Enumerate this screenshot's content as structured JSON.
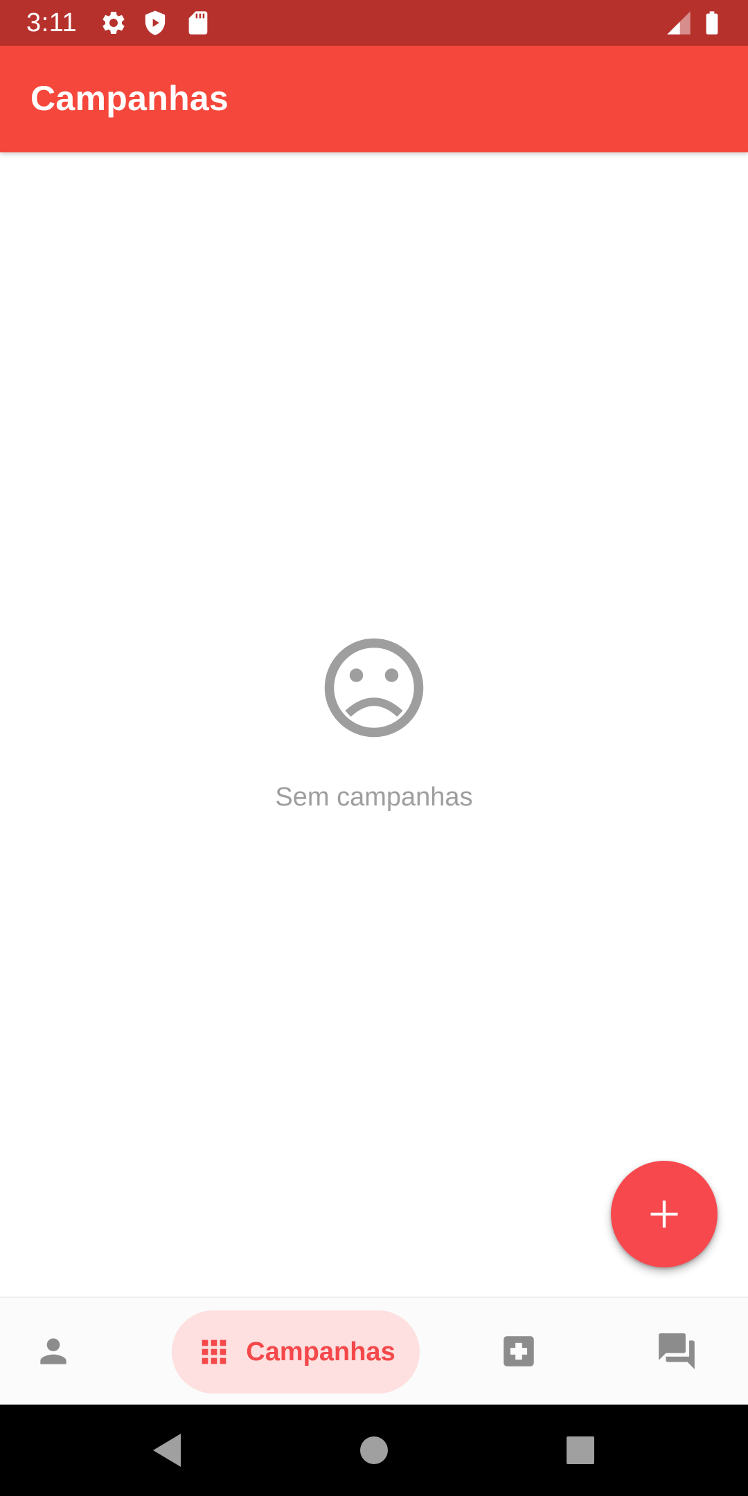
{
  "status_bar": {
    "time": "3:11",
    "icons": [
      "gear-icon",
      "shield-play-icon",
      "sd-card-icon",
      "signal-icon",
      "battery-icon"
    ]
  },
  "app_bar": {
    "title": "Campanhas"
  },
  "empty_state": {
    "icon": "sad-face-icon",
    "message": "Sem campanhas"
  },
  "fab": {
    "icon": "plus-icon"
  },
  "bottom_nav": {
    "items": [
      {
        "icon": "person-icon",
        "label": ""
      },
      {
        "icon": "apps-grid-icon",
        "label": "Campanhas",
        "active": true
      },
      {
        "icon": "medical-plus-icon",
        "label": ""
      },
      {
        "icon": "forum-icon",
        "label": ""
      }
    ]
  },
  "system_nav": {
    "buttons": [
      "back-icon",
      "home-icon",
      "recents-icon"
    ]
  },
  "colors": {
    "status_bar": "#b7312c",
    "app_bar": "#f6473c",
    "accent": "#f7484d",
    "active_pill": "#fde0df",
    "muted_icon": "#9e9e9e"
  }
}
